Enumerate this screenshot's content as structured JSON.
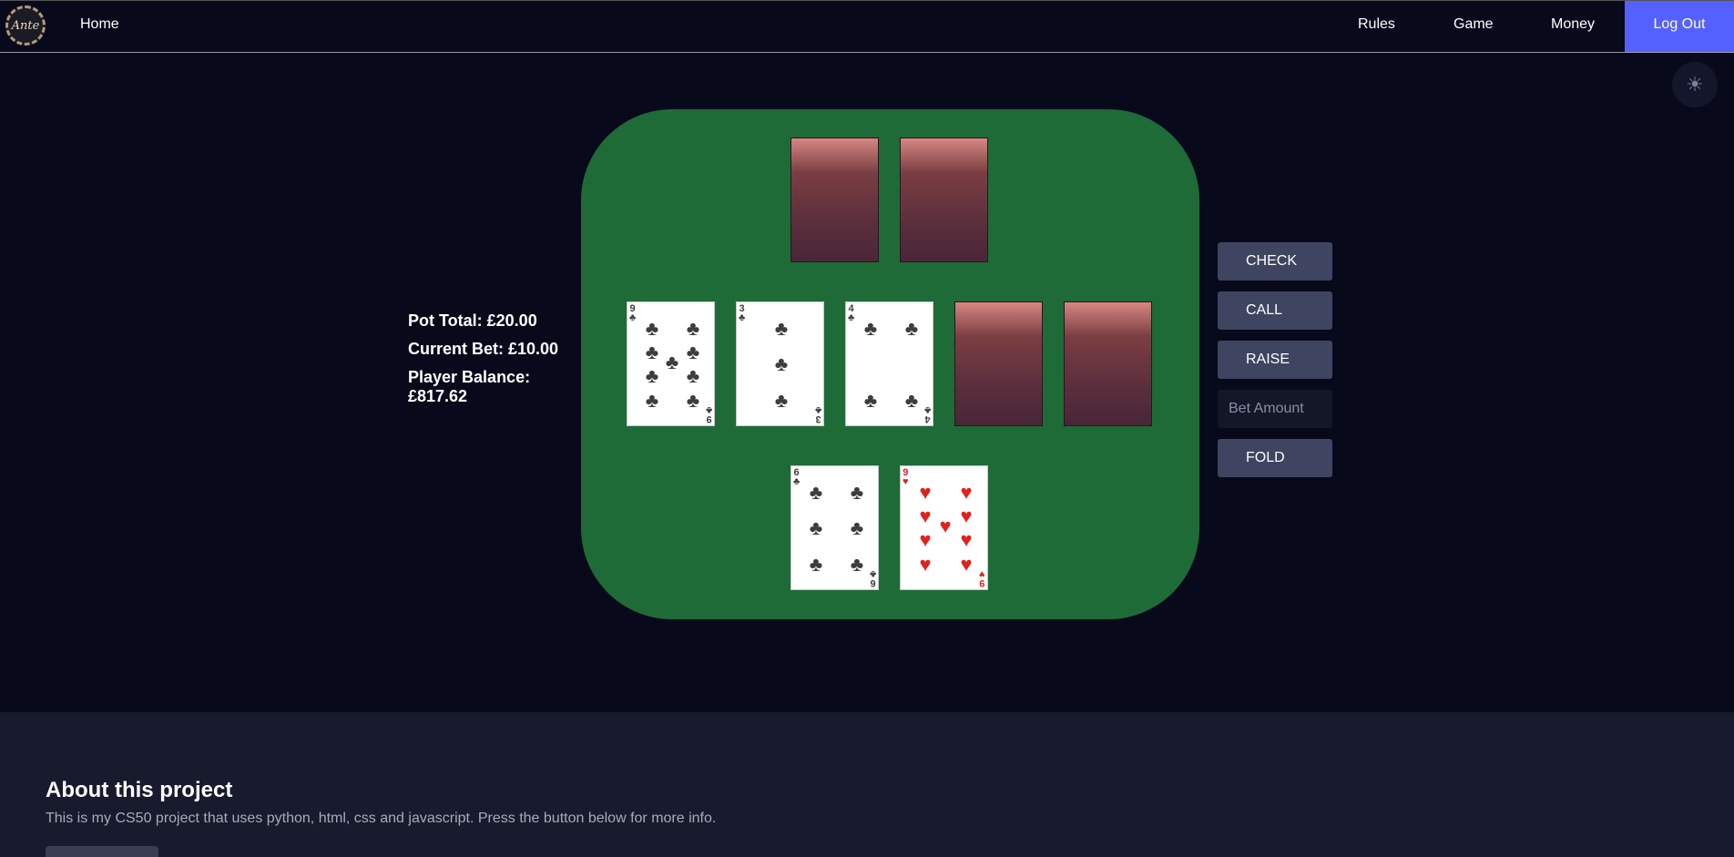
{
  "nav": {
    "logo_text": "Ante",
    "home": "Home",
    "rules": "Rules",
    "game": "Game",
    "money": "Money",
    "logout": "Log Out"
  },
  "theme_toggle": {
    "icon": "sun-icon",
    "glyph": "☀"
  },
  "stats": {
    "pot_total": "Pot Total: £20.00",
    "current_bet": "Current Bet: £10.00",
    "player_balance": "Player Balance: £817.62"
  },
  "opponent_hand": [
    {
      "face_down": true
    },
    {
      "face_down": true
    }
  ],
  "community_cards": [
    {
      "rank": "9",
      "suit": "♣",
      "color": "black"
    },
    {
      "rank": "3",
      "suit": "♣",
      "color": "black"
    },
    {
      "rank": "4",
      "suit": "♣",
      "color": "black"
    },
    {
      "face_down": true
    },
    {
      "face_down": true
    }
  ],
  "player_hand": [
    {
      "rank": "6",
      "suit": "♣",
      "color": "black"
    },
    {
      "rank": "9",
      "suit": "♥",
      "color": "red"
    }
  ],
  "actions": {
    "check": "CHECK",
    "call": "CALL",
    "raise": "RAISE",
    "bet_placeholder": "Bet Amount",
    "fold": "FOLD"
  },
  "footer": {
    "title": "About this project",
    "text": "This is my CS50 project that uses python, html, css and javascript. Press the button below for more info."
  },
  "colors": {
    "background": "#080a1c",
    "table": "#1e6b37",
    "accent": "#5561ff",
    "button": "#3f4460",
    "footer": "#181a2e"
  }
}
